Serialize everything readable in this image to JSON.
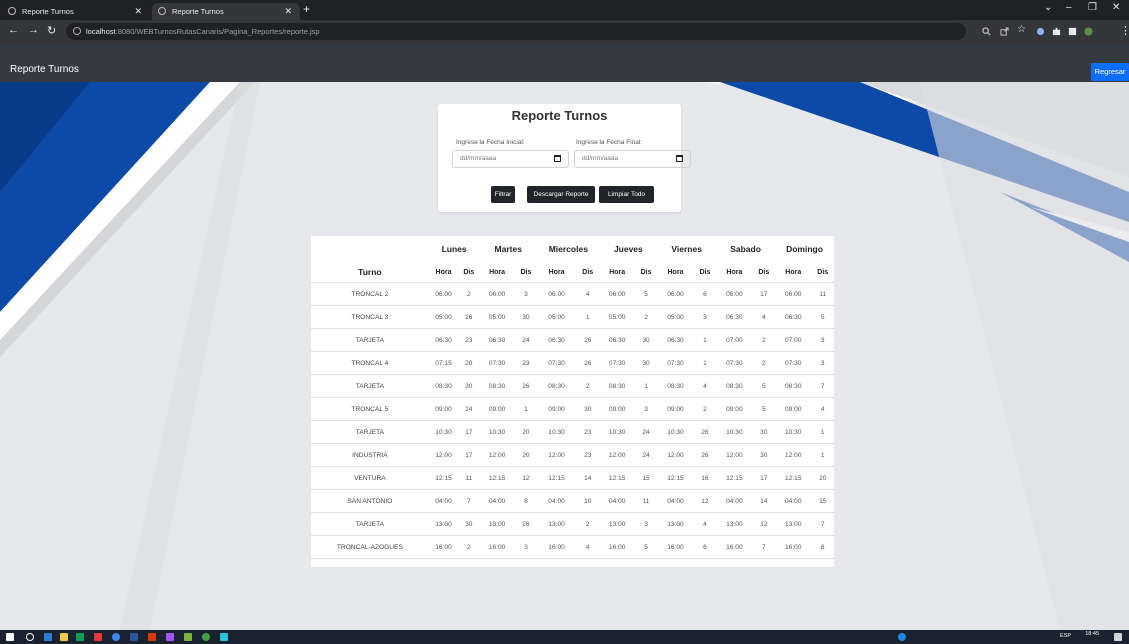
{
  "browser": {
    "tabs": [
      {
        "label": "Reporte Turnos"
      },
      {
        "label": "Reporte Turnos"
      }
    ],
    "url_host": "localhost",
    "url_rest": ":8080/WEBTurnosRutasCanaris/Pagina_Reportes/reporte.jsp"
  },
  "navbar": {
    "brand": "Reporte Turnos",
    "back_button": "Regresar"
  },
  "report": {
    "title": "Reporte Turnos",
    "start_label": "Ingrese la Fecha Inicial:",
    "end_label": "Ingrese la Fecha Final:",
    "start_placeholder": "dd/mm/aaaa",
    "end_placeholder": "dd/mm/aaaa",
    "filter_button": "Filtrar",
    "download_button": "Descargar Reporte",
    "clear_button": "Limpiar Todo"
  },
  "table": {
    "turno_header": "Turno",
    "hora_header": "Hora",
    "dis_header": "Dis",
    "days": [
      "Lunes",
      "Martes",
      "Miercoles",
      "Jueves",
      "Viernes",
      "Sabado",
      "Domingo"
    ],
    "rows": [
      {
        "turno": "TRONCAL 2",
        "cells": [
          "06:00",
          "2",
          "06:00",
          "3",
          "06:00",
          "4",
          "06:00",
          "5",
          "06:00",
          "6",
          "06:00",
          "17",
          "06:00",
          "11"
        ]
      },
      {
        "turno": "TRONCAL 3",
        "cells": [
          "05:00",
          "26",
          "05:00",
          "30",
          "05:00",
          "1",
          "05:00",
          "2",
          "05:00",
          "3",
          "06:30",
          "4",
          "06:30",
          "5"
        ]
      },
      {
        "turno": "TARJETA",
        "cells": [
          "06:30",
          "23",
          "06:30",
          "24",
          "06:30",
          "26",
          "06:30",
          "30",
          "06:30",
          "1",
          "07:00",
          "2",
          "07:00",
          "3"
        ]
      },
      {
        "turno": "TRONCAL 4",
        "cells": [
          "07:15",
          "20",
          "07:30",
          "23",
          "07:30",
          "26",
          "07:30",
          "30",
          "07:30",
          "1",
          "07:30",
          "2",
          "07:30",
          "3"
        ]
      },
      {
        "turno": "TARJETA",
        "cells": [
          "08:30",
          "30",
          "08:30",
          "26",
          "08:30",
          "2",
          "08:30",
          "1",
          "08:30",
          "4",
          "08:30",
          "5",
          "08:30",
          "7"
        ]
      },
      {
        "turno": "TRONCAL 5",
        "cells": [
          "09:00",
          "24",
          "09:00",
          "1",
          "09:00",
          "30",
          "09:00",
          "3",
          "09:00",
          "2",
          "09:00",
          "5",
          "09:00",
          "4"
        ]
      },
      {
        "turno": "TARJETA",
        "cells": [
          "10:30",
          "17",
          "10:30",
          "20",
          "10:30",
          "23",
          "10:30",
          "24",
          "10:30",
          "26",
          "10:30",
          "30",
          "10:30",
          "1"
        ]
      },
      {
        "turno": "INDUSTRIA",
        "cells": [
          "12:00",
          "17",
          "12:00",
          "20",
          "12:00",
          "23",
          "12:00",
          "24",
          "12:00",
          "26",
          "12:00",
          "30",
          "12:00",
          "1"
        ]
      },
      {
        "turno": "VENTURA",
        "cells": [
          "12:15",
          "11",
          "12:15",
          "12",
          "12:15",
          "14",
          "12:15",
          "15",
          "12:15",
          "16",
          "12:15",
          "17",
          "12:15",
          "20"
        ]
      },
      {
        "turno": "SAN ANTONIO",
        "cells": [
          "04:00",
          "7",
          "04:00",
          "8",
          "04:00",
          "10",
          "04:00",
          "11",
          "04:00",
          "12",
          "04:00",
          "14",
          "04:00",
          "15"
        ]
      },
      {
        "turno": "TARJETA",
        "cells": [
          "13:00",
          "30",
          "13:00",
          "26",
          "13:00",
          "2",
          "13:00",
          "3",
          "13:00",
          "4",
          "13:00",
          "12",
          "13:00",
          "7"
        ]
      },
      {
        "turno": "TRONCAL-AZOGUES",
        "cells": [
          "16:00",
          "2",
          "16:00",
          "3",
          "16:00",
          "4",
          "16:00",
          "5",
          "16:00",
          "6",
          "16:00",
          "7",
          "16:00",
          "8"
        ]
      }
    ]
  },
  "taskbar": {
    "time": "18:45",
    "lang": "ESP"
  }
}
